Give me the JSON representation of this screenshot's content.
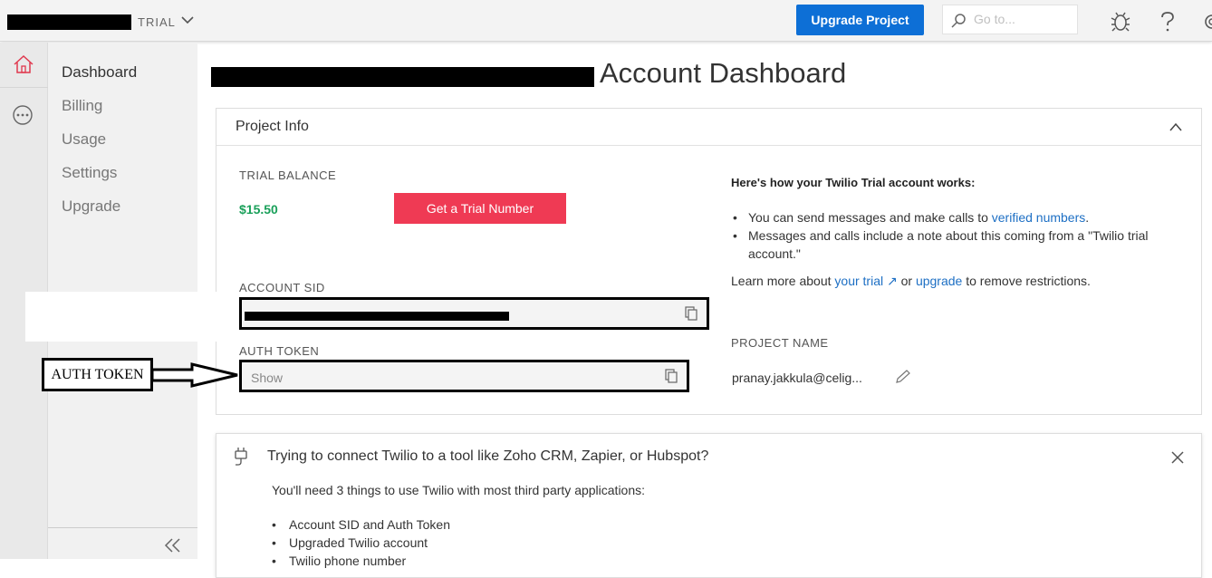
{
  "topbar": {
    "trial_label": "TRIAL",
    "upgrade_button": "Upgrade Project",
    "search_placeholder": "Go to..."
  },
  "nav": {
    "items": [
      {
        "label": "Dashboard",
        "active": true
      },
      {
        "label": "Billing"
      },
      {
        "label": "Usage"
      },
      {
        "label": "Settings"
      },
      {
        "label": "Upgrade"
      }
    ]
  },
  "page": {
    "title": "Account Dashboard"
  },
  "project_info": {
    "heading": "Project Info",
    "trial_balance_label": "TRIAL BALANCE",
    "trial_balance_value": "$15.50",
    "trial_number_button": "Get a Trial Number",
    "account_sid_label": "ACCOUNT SID",
    "auth_token_label": "AUTH TOKEN",
    "auth_token_value": "Show",
    "how_title": "Here's how your Twilio Trial account works:",
    "how_item_1_prefix": "You can send messages and make calls to ",
    "how_item_1_link": "verified numbers",
    "how_item_1_suffix": ".",
    "how_item_2": "Messages and calls include a note about this coming from a \"Twilio trial account.\"",
    "learn_prefix": "Learn more about ",
    "learn_link_1": "your trial ↗",
    "learn_mid": " or ",
    "learn_link_2": "upgrade",
    "learn_suffix": " to remove restrictions.",
    "project_name_label": "PROJECT NAME",
    "project_name_value": "pranay.jakkula@celig..."
  },
  "integration_card": {
    "title": "Trying to connect Twilio to a tool like Zoho CRM, Zapier, or Hubspot?",
    "subtitle": "You'll need 3 things to use Twilio with most third party applications:",
    "items": [
      "Account SID and Auth Token",
      "Upgraded Twilio account",
      "Twilio phone number"
    ]
  },
  "annotation": {
    "label": "AUTH TOKEN"
  },
  "colors": {
    "brand_blue": "#0d6fd6",
    "trial_red": "#ef3a54",
    "balance_green": "#1aa05a",
    "link_blue": "#1d6fc4"
  }
}
